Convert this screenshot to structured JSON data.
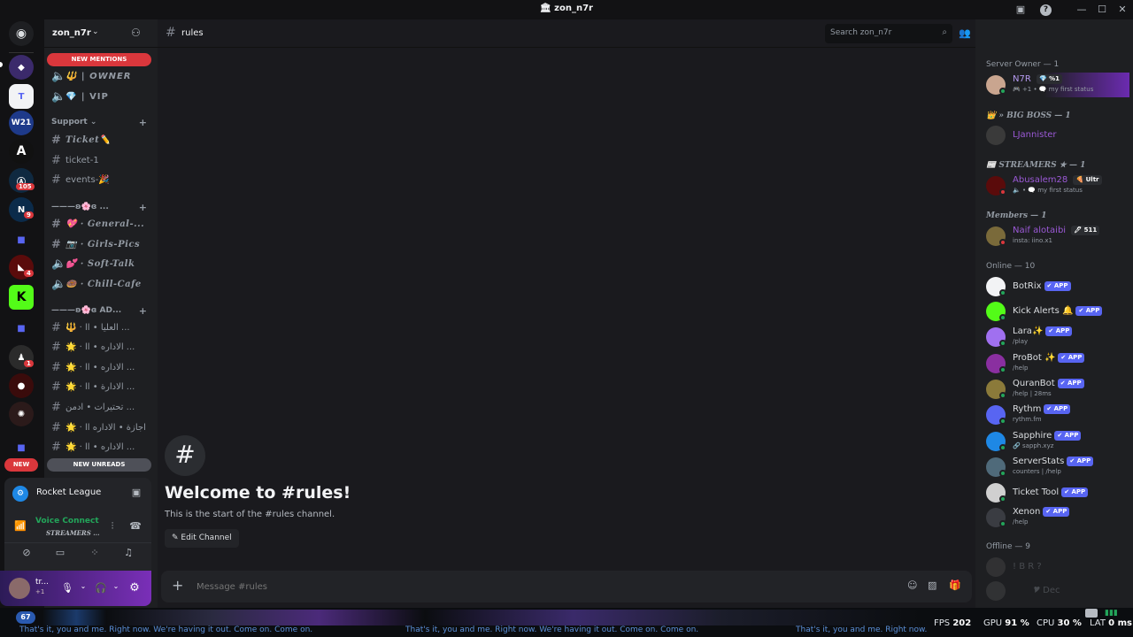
{
  "window": {
    "title": "zon_n7r"
  },
  "guilds": {
    "badges": [
      "105",
      "9",
      "4",
      "1"
    ],
    "home_icon": "discord-logo"
  },
  "server": {
    "name": "zon_n7r"
  },
  "sidebar": {
    "new_mentions": "NEW MENTIONS",
    "new_unreads": "NEW UNREADS",
    "new_badge": "NEW",
    "top_channels": [
      {
        "label": "🔱 | OWNER",
        "type": "voice"
      },
      {
        "label": "💎 | VIP",
        "type": "voice"
      }
    ],
    "support": {
      "category": "Support",
      "channels": [
        {
          "label": "Ticket✏️",
          "type": "text",
          "serif": true
        },
        {
          "label": "ticket-1",
          "type": "text"
        },
        {
          "label": "events-🎉",
          "type": "text"
        }
      ]
    },
    "cat2": {
      "category": "———ʚ🌸ɞ ...",
      "channels": [
        {
          "label": "💖 · General-...",
          "type": "text"
        },
        {
          "label": "📷 · Girls-Pics",
          "type": "text"
        },
        {
          "label": "💕 · Soft-Talk",
          "type": "voice"
        },
        {
          "label": "🍩 · Chill-Cafe",
          "type": "voice"
        }
      ]
    },
    "cat3": {
      "category": "———ʚ🌸ɞ AD...",
      "channels": [
        {
          "label": "🔱 · العليا • اا ...",
          "type": "text"
        },
        {
          "label": "🌟 · الاداره • اا ...",
          "type": "text"
        },
        {
          "label": "🌟 · الاداره • اا ...",
          "type": "text"
        },
        {
          "label": "🌟 · الادارة • اا ...",
          "type": "text"
        },
        {
          "label": "تحتيرات • ادمن ...",
          "type": "text"
        },
        {
          "label": "🌟 · اجازة • الاداره اا",
          "type": "text"
        },
        {
          "label": "🌟 · الاداره • اا ...",
          "type": "text"
        }
      ]
    }
  },
  "activity": {
    "game": "Rocket League",
    "voice_status": "Voice Connecte",
    "voice_channel": "STREAMERS ..."
  },
  "user": {
    "name": "tr...",
    "sub": "+1"
  },
  "chat": {
    "channel": "rules",
    "welcome_title": "Welcome to #rules!",
    "welcome_sub": "This is the start of the #rules channel.",
    "edit_button": "Edit Channel",
    "composer_placeholder": "Message #rules",
    "search_placeholder": "Search zon_n7r"
  },
  "members": {
    "groups": [
      {
        "title": "Server Owner — 1",
        "italic": false
      },
      {
        "title": "👑 » BIG BOSS — 1",
        "italic": true
      },
      {
        "title": "📰 STREAMERS ★ — 1",
        "italic": true
      },
      {
        "title": "Members — 1",
        "italic": true
      },
      {
        "title": "Online — 10",
        "italic": false
      },
      {
        "title": "Offline — 9",
        "italic": false
      }
    ],
    "people": [
      {
        "name": "N7R",
        "tag": "💎 %1",
        "sub": "🎮 +1 • 🗨️ my first status",
        "color": "#b59af0"
      },
      {
        "name": "LJannister",
        "tag": "",
        "sub": "",
        "color": "#9b59d6"
      },
      {
        "name": "Abusalem28",
        "tag": "🍕 Ultr",
        "sub": "🔈 • 🗨️ my first status",
        "color": "#9b59d6"
      },
      {
        "name": "Naif alotaibi",
        "tag": "🖊 511",
        "sub": "insta: iino.x1",
        "color": "#9b59d6"
      }
    ],
    "apps": [
      {
        "name": "BotRix",
        "sub": "",
        "extra": "",
        "color": "#f2f3f5"
      },
      {
        "name": "Kick Alerts 🔔",
        "sub": "",
        "extra": "",
        "color": "#53fc18"
      },
      {
        "name": "Lara✨",
        "sub": "/play",
        "extra": "",
        "color": "#a070f0"
      },
      {
        "name": "ProBot ✨",
        "sub": "/help",
        "extra": "",
        "color": "#8a2fa0"
      },
      {
        "name": "QuranBot",
        "sub": "/help | 28ms",
        "extra": "",
        "color": "#8b7a3a"
      },
      {
        "name": "Rythm",
        "sub": "rythm.fm",
        "extra": "",
        "color": "#5865f2"
      },
      {
        "name": "Sapphire",
        "sub": "🔗 sapph.xyz",
        "extra": "",
        "color": "#1e88e5"
      },
      {
        "name": "ServerStats",
        "sub": "counters | /help",
        "extra": "",
        "color": "#4f6a7a"
      },
      {
        "name": "Ticket Tool",
        "sub": "",
        "extra": "",
        "color": "#f2f3f5"
      },
      {
        "name": "Xenon",
        "sub": "/help",
        "extra": "",
        "color": "#2b2d31"
      }
    ],
    "app_label": "✔ APP",
    "offline": [
      {
        "name": "! B R ?",
        "sub": ""
      },
      {
        "name": "",
        "sub": "🎔 Dec"
      }
    ]
  },
  "taskbar": {
    "ticker": "That's it, you and me. Right now. We're having it out. Come on. Come on.",
    "fps_label": "FPS",
    "fps": "202",
    "gpu_label": "GPU",
    "gpu": "91 %",
    "cpu_label": "CPU",
    "cpu": "30 %",
    "lat_label": "LAT",
    "lat": "0 ms",
    "level": "67"
  }
}
